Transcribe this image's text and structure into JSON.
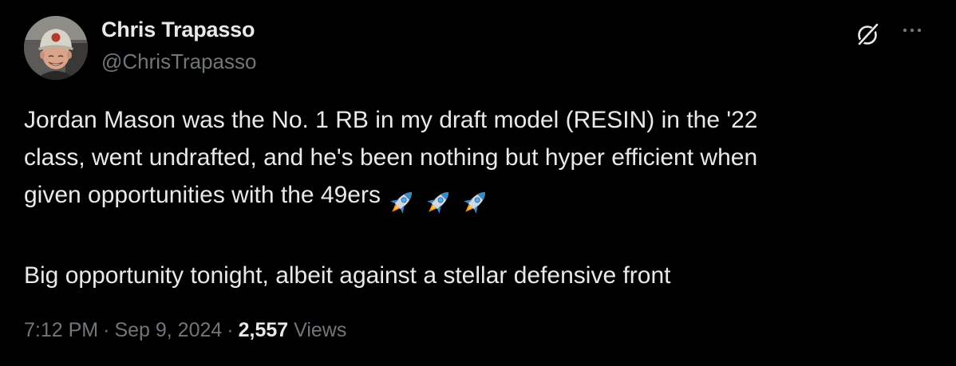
{
  "author": {
    "name": "Chris Trapasso",
    "handle": "@ChrisTrapasso"
  },
  "header_icons": [
    "grok-icon",
    "more-icon"
  ],
  "tweet": {
    "lines": [
      "Jordan Mason was the No. 1 RB in my draft model (RESIN) in the '22",
      "class, went undrafted, and he's been nothing but hyper efficient when",
      "given opportunities with the 49ers"
    ],
    "emoji": [
      "rocket",
      "rocket",
      "rocket"
    ],
    "paragraph2": "Big opportunity tonight, albeit against a stellar defensive front"
  },
  "meta": {
    "time": "7:12 PM",
    "separator": "·",
    "date": "Sep 9, 2024",
    "views_count": "2,557",
    "views_label": "Views"
  },
  "colors": {
    "background": "#000000",
    "text": "#e7e9ea",
    "secondary": "#71767b"
  }
}
